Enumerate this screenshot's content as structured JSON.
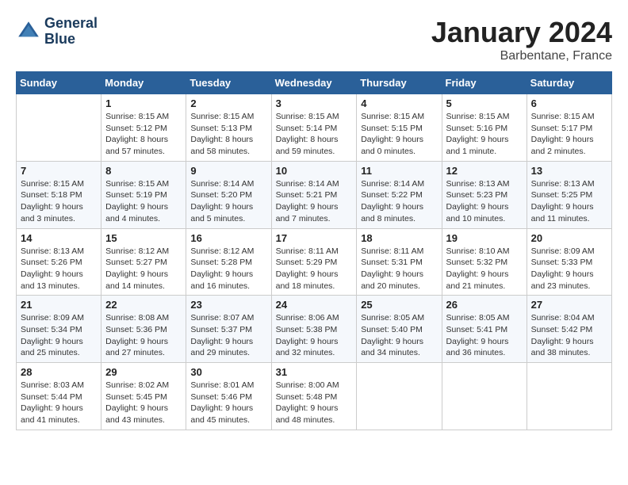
{
  "header": {
    "logo_line1": "General",
    "logo_line2": "Blue",
    "month_title": "January 2024",
    "location": "Barbentane, France"
  },
  "calendar": {
    "days_of_week": [
      "Sunday",
      "Monday",
      "Tuesday",
      "Wednesday",
      "Thursday",
      "Friday",
      "Saturday"
    ],
    "weeks": [
      [
        {
          "day": "",
          "info": ""
        },
        {
          "day": "1",
          "info": "Sunrise: 8:15 AM\nSunset: 5:12 PM\nDaylight: 8 hours\nand 57 minutes."
        },
        {
          "day": "2",
          "info": "Sunrise: 8:15 AM\nSunset: 5:13 PM\nDaylight: 8 hours\nand 58 minutes."
        },
        {
          "day": "3",
          "info": "Sunrise: 8:15 AM\nSunset: 5:14 PM\nDaylight: 8 hours\nand 59 minutes."
        },
        {
          "day": "4",
          "info": "Sunrise: 8:15 AM\nSunset: 5:15 PM\nDaylight: 9 hours\nand 0 minutes."
        },
        {
          "day": "5",
          "info": "Sunrise: 8:15 AM\nSunset: 5:16 PM\nDaylight: 9 hours\nand 1 minute."
        },
        {
          "day": "6",
          "info": "Sunrise: 8:15 AM\nSunset: 5:17 PM\nDaylight: 9 hours\nand 2 minutes."
        }
      ],
      [
        {
          "day": "7",
          "info": "Sunrise: 8:15 AM\nSunset: 5:18 PM\nDaylight: 9 hours\nand 3 minutes."
        },
        {
          "day": "8",
          "info": "Sunrise: 8:15 AM\nSunset: 5:19 PM\nDaylight: 9 hours\nand 4 minutes."
        },
        {
          "day": "9",
          "info": "Sunrise: 8:14 AM\nSunset: 5:20 PM\nDaylight: 9 hours\nand 5 minutes."
        },
        {
          "day": "10",
          "info": "Sunrise: 8:14 AM\nSunset: 5:21 PM\nDaylight: 9 hours\nand 7 minutes."
        },
        {
          "day": "11",
          "info": "Sunrise: 8:14 AM\nSunset: 5:22 PM\nDaylight: 9 hours\nand 8 minutes."
        },
        {
          "day": "12",
          "info": "Sunrise: 8:13 AM\nSunset: 5:23 PM\nDaylight: 9 hours\nand 10 minutes."
        },
        {
          "day": "13",
          "info": "Sunrise: 8:13 AM\nSunset: 5:25 PM\nDaylight: 9 hours\nand 11 minutes."
        }
      ],
      [
        {
          "day": "14",
          "info": "Sunrise: 8:13 AM\nSunset: 5:26 PM\nDaylight: 9 hours\nand 13 minutes."
        },
        {
          "day": "15",
          "info": "Sunrise: 8:12 AM\nSunset: 5:27 PM\nDaylight: 9 hours\nand 14 minutes."
        },
        {
          "day": "16",
          "info": "Sunrise: 8:12 AM\nSunset: 5:28 PM\nDaylight: 9 hours\nand 16 minutes."
        },
        {
          "day": "17",
          "info": "Sunrise: 8:11 AM\nSunset: 5:29 PM\nDaylight: 9 hours\nand 18 minutes."
        },
        {
          "day": "18",
          "info": "Sunrise: 8:11 AM\nSunset: 5:31 PM\nDaylight: 9 hours\nand 20 minutes."
        },
        {
          "day": "19",
          "info": "Sunrise: 8:10 AM\nSunset: 5:32 PM\nDaylight: 9 hours\nand 21 minutes."
        },
        {
          "day": "20",
          "info": "Sunrise: 8:09 AM\nSunset: 5:33 PM\nDaylight: 9 hours\nand 23 minutes."
        }
      ],
      [
        {
          "day": "21",
          "info": "Sunrise: 8:09 AM\nSunset: 5:34 PM\nDaylight: 9 hours\nand 25 minutes."
        },
        {
          "day": "22",
          "info": "Sunrise: 8:08 AM\nSunset: 5:36 PM\nDaylight: 9 hours\nand 27 minutes."
        },
        {
          "day": "23",
          "info": "Sunrise: 8:07 AM\nSunset: 5:37 PM\nDaylight: 9 hours\nand 29 minutes."
        },
        {
          "day": "24",
          "info": "Sunrise: 8:06 AM\nSunset: 5:38 PM\nDaylight: 9 hours\nand 32 minutes."
        },
        {
          "day": "25",
          "info": "Sunrise: 8:05 AM\nSunset: 5:40 PM\nDaylight: 9 hours\nand 34 minutes."
        },
        {
          "day": "26",
          "info": "Sunrise: 8:05 AM\nSunset: 5:41 PM\nDaylight: 9 hours\nand 36 minutes."
        },
        {
          "day": "27",
          "info": "Sunrise: 8:04 AM\nSunset: 5:42 PM\nDaylight: 9 hours\nand 38 minutes."
        }
      ],
      [
        {
          "day": "28",
          "info": "Sunrise: 8:03 AM\nSunset: 5:44 PM\nDaylight: 9 hours\nand 41 minutes."
        },
        {
          "day": "29",
          "info": "Sunrise: 8:02 AM\nSunset: 5:45 PM\nDaylight: 9 hours\nand 43 minutes."
        },
        {
          "day": "30",
          "info": "Sunrise: 8:01 AM\nSunset: 5:46 PM\nDaylight: 9 hours\nand 45 minutes."
        },
        {
          "day": "31",
          "info": "Sunrise: 8:00 AM\nSunset: 5:48 PM\nDaylight: 9 hours\nand 48 minutes."
        },
        {
          "day": "",
          "info": ""
        },
        {
          "day": "",
          "info": ""
        },
        {
          "day": "",
          "info": ""
        }
      ]
    ]
  }
}
